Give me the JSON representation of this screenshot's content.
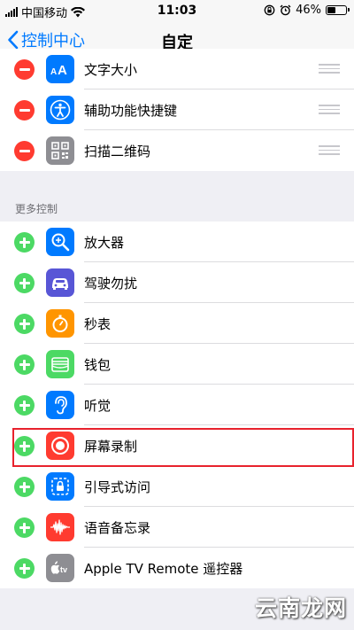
{
  "status_bar": {
    "carrier": "中国移动",
    "time": "11:03",
    "battery": "46%",
    "battery_level": 0.46,
    "icons": [
      "signal-icon",
      "wifi-icon",
      "orientation-lock-icon",
      "alarm-icon",
      "battery-icon"
    ]
  },
  "nav": {
    "back_label": "控制中心",
    "title": "自定"
  },
  "included": [
    {
      "label": "文字大小",
      "icon": "text-size-icon",
      "color": "#007aff"
    },
    {
      "label": "辅助功能快捷键",
      "icon": "accessibility-icon",
      "color": "#007aff"
    },
    {
      "label": "扫描二维码",
      "icon": "qr-code-icon",
      "color": "#8e8e93"
    }
  ],
  "section_header": "更多控制",
  "more": [
    {
      "label": "放大器",
      "icon": "magnifier-icon",
      "color": "#007aff"
    },
    {
      "label": "驾驶勿扰",
      "icon": "car-icon",
      "color": "#5856d6"
    },
    {
      "label": "秒表",
      "icon": "stopwatch-icon",
      "color": "#ff9500"
    },
    {
      "label": "钱包",
      "icon": "wallet-icon",
      "color": "#4cd964"
    },
    {
      "label": "听觉",
      "icon": "ear-icon",
      "color": "#007aff"
    },
    {
      "label": "屏幕录制",
      "icon": "screen-record-icon",
      "color": "#ff3b30"
    },
    {
      "label": "引导式访问",
      "icon": "guided-access-icon",
      "color": "#007aff"
    },
    {
      "label": "语音备忘录",
      "icon": "voice-memo-icon",
      "color": "#ff3b30"
    },
    {
      "label": "Apple TV Remote 遥控器",
      "icon": "apple-tv-icon",
      "color": "#8e8e93"
    }
  ],
  "colors": {
    "accent": "#007aff",
    "remove": "#ff3b30",
    "add": "#4cd964",
    "highlight": "#e8222d"
  },
  "watermark": "云南龙网"
}
